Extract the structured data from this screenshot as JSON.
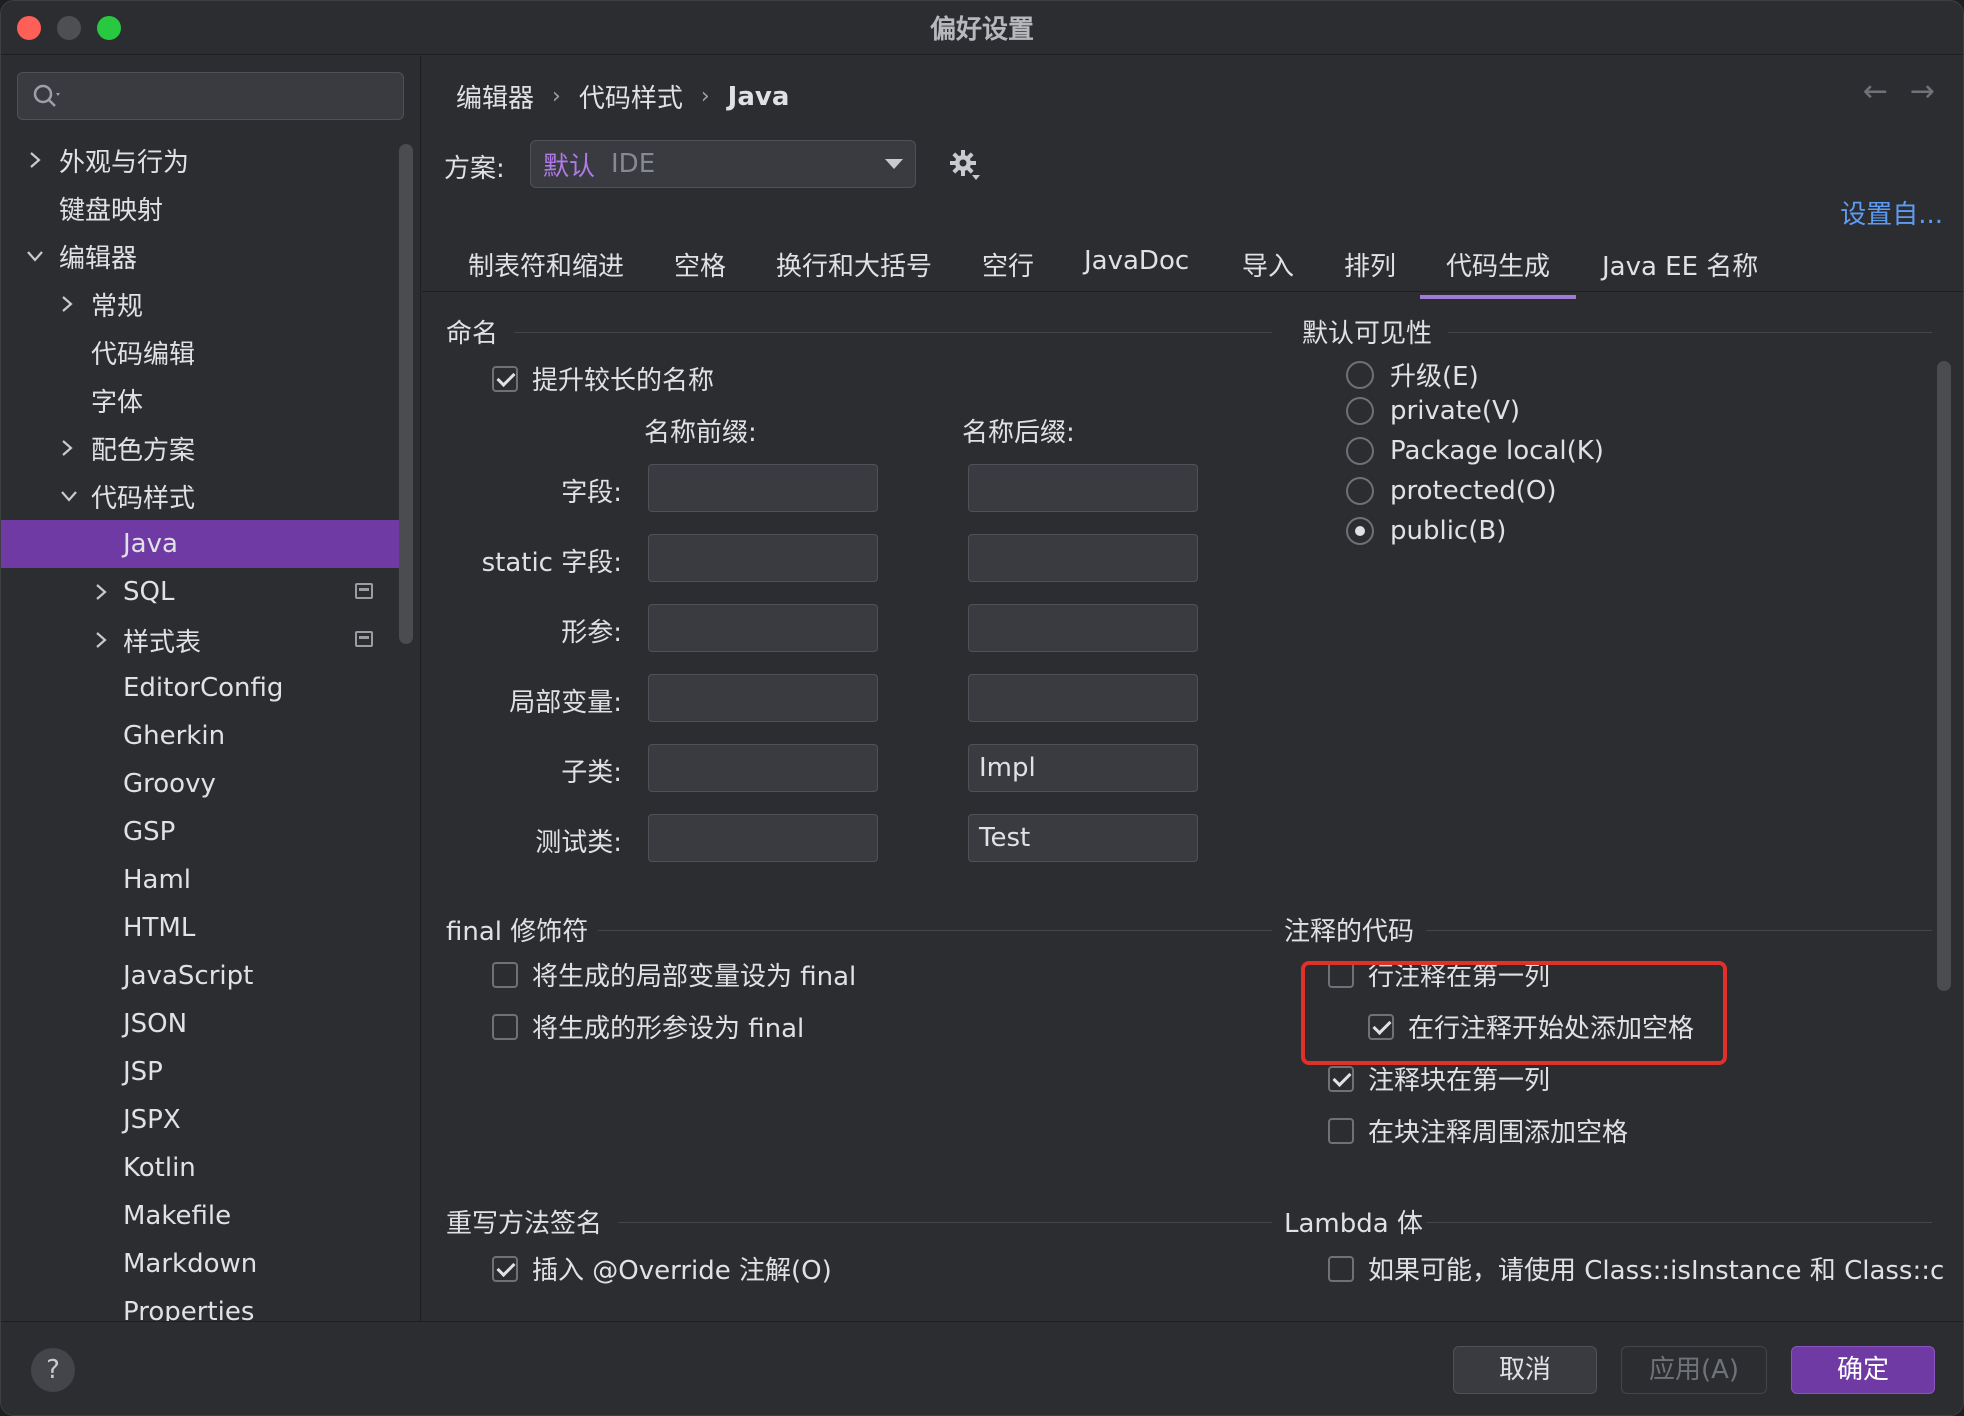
{
  "window": {
    "title": "偏好设置"
  },
  "sidebar": {
    "search_placeholder": "",
    "items": [
      {
        "label": "外观与行为"
      },
      {
        "label": "键盘映射"
      },
      {
        "label": "编辑器"
      },
      {
        "label": "常规"
      },
      {
        "label": "代码编辑"
      },
      {
        "label": "字体"
      },
      {
        "label": "配色方案"
      },
      {
        "label": "代码样式"
      },
      {
        "label": "Java",
        "selected": true
      },
      {
        "label": "SQL"
      },
      {
        "label": "样式表"
      },
      {
        "label": "EditorConfig"
      },
      {
        "label": "Gherkin"
      },
      {
        "label": "Groovy"
      },
      {
        "label": "GSP"
      },
      {
        "label": "Haml"
      },
      {
        "label": "HTML"
      },
      {
        "label": "JavaScript"
      },
      {
        "label": "JSON"
      },
      {
        "label": "JSP"
      },
      {
        "label": "JSPX"
      },
      {
        "label": "Kotlin"
      },
      {
        "label": "Makefile"
      },
      {
        "label": "Markdown"
      },
      {
        "label": "Properties"
      }
    ]
  },
  "breadcrumb": [
    "编辑器",
    "代码样式",
    "Java"
  ],
  "scheme": {
    "label": "方案:",
    "value_primary": "默认",
    "value_secondary": "IDE"
  },
  "set_from_link": "设置自...",
  "tabs": [
    "制表符和缩进",
    "空格",
    "换行和大括号",
    "空行",
    "JavaDoc",
    "导入",
    "排列",
    "代码生成",
    "Java EE 名称"
  ],
  "active_tab": "代码生成",
  "naming": {
    "title": "命名",
    "prefer_longer": {
      "label": "提升较长的名称",
      "checked": true
    },
    "prefix_header": "名称前缀:",
    "suffix_header": "名称后缀:",
    "rows": [
      {
        "label": "字段:",
        "prefix": "",
        "suffix": ""
      },
      {
        "label": "static 字段:",
        "prefix": "",
        "suffix": ""
      },
      {
        "label": "形参:",
        "prefix": "",
        "suffix": ""
      },
      {
        "label": "局部变量:",
        "prefix": "",
        "suffix": ""
      },
      {
        "label": "子类:",
        "prefix": "",
        "suffix": "Impl"
      },
      {
        "label": "测试类:",
        "prefix": "",
        "suffix": "Test"
      }
    ]
  },
  "visibility": {
    "title": "默认可见性",
    "options": [
      {
        "label": "升级(E)",
        "selected": false
      },
      {
        "label": "private(V)",
        "selected": false
      },
      {
        "label": "Package local(K)",
        "selected": false
      },
      {
        "label": "protected(O)",
        "selected": false
      },
      {
        "label": "public(B)",
        "selected": true
      }
    ]
  },
  "final_modifier": {
    "title": "final 修饰符",
    "options": [
      {
        "label": "将生成的局部变量设为 final",
        "checked": false
      },
      {
        "label": "将生成的形参设为 final",
        "checked": false
      }
    ]
  },
  "commented_code": {
    "title": "注释的代码",
    "options": [
      {
        "label": "行注释在第一列",
        "checked": false
      },
      {
        "label": "在行注释开始处添加空格",
        "checked": true
      },
      {
        "label": "注释块在第一列",
        "checked": true
      },
      {
        "label": "在块注释周围添加空格",
        "checked": false
      }
    ]
  },
  "override": {
    "title": "重写方法签名",
    "options": [
      {
        "label": "插入 @Override 注解(O)",
        "checked": true
      }
    ]
  },
  "lambda": {
    "title": "Lambda 体",
    "options": [
      {
        "label": "如果可能，请使用 Class::isInstance 和 Class::c",
        "checked": false
      }
    ]
  },
  "buttons": {
    "cancel": "取消",
    "apply": "应用(A)",
    "ok": "确定",
    "help": "?"
  }
}
